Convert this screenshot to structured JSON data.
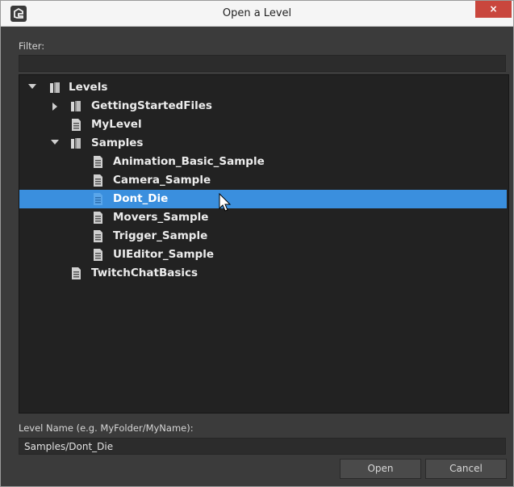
{
  "window": {
    "title": "Open a Level",
    "close_glyph": "×"
  },
  "filter": {
    "label": "Filter:",
    "value": ""
  },
  "tree": {
    "items": [
      {
        "label": "Levels",
        "icon": "folder-icon",
        "expanded": true,
        "depth": 0
      },
      {
        "label": "GettingStartedFiles",
        "icon": "folder-icon",
        "expanded": false,
        "depth": 1
      },
      {
        "label": "MyLevel",
        "icon": "level-file-icon",
        "depth": 1
      },
      {
        "label": "Samples",
        "icon": "folder-icon",
        "expanded": true,
        "depth": 1
      },
      {
        "label": "Animation_Basic_Sample",
        "icon": "level-file-icon",
        "depth": 2
      },
      {
        "label": "Camera_Sample",
        "icon": "level-file-icon",
        "depth": 2
      },
      {
        "label": "Dont_Die",
        "icon": "level-file-icon",
        "depth": 2,
        "selected": true
      },
      {
        "label": "Movers_Sample",
        "icon": "level-file-icon",
        "depth": 2
      },
      {
        "label": "Trigger_Sample",
        "icon": "level-file-icon",
        "depth": 2
      },
      {
        "label": "UIEditor_Sample",
        "icon": "level-file-icon",
        "depth": 2
      },
      {
        "label": "TwitchChatBasics",
        "icon": "level-file-icon",
        "depth": 1
      }
    ]
  },
  "level_name": {
    "label": "Level Name (e.g. MyFolder/MyName):",
    "value": "Samples/Dont_Die"
  },
  "buttons": {
    "open_label": "Open",
    "cancel_label": "Cancel"
  },
  "colors": {
    "selection": "#3a8fde",
    "close_button": "#c9463d",
    "panel_bg": "#222222",
    "dialog_bg": "#3b3b3b"
  }
}
